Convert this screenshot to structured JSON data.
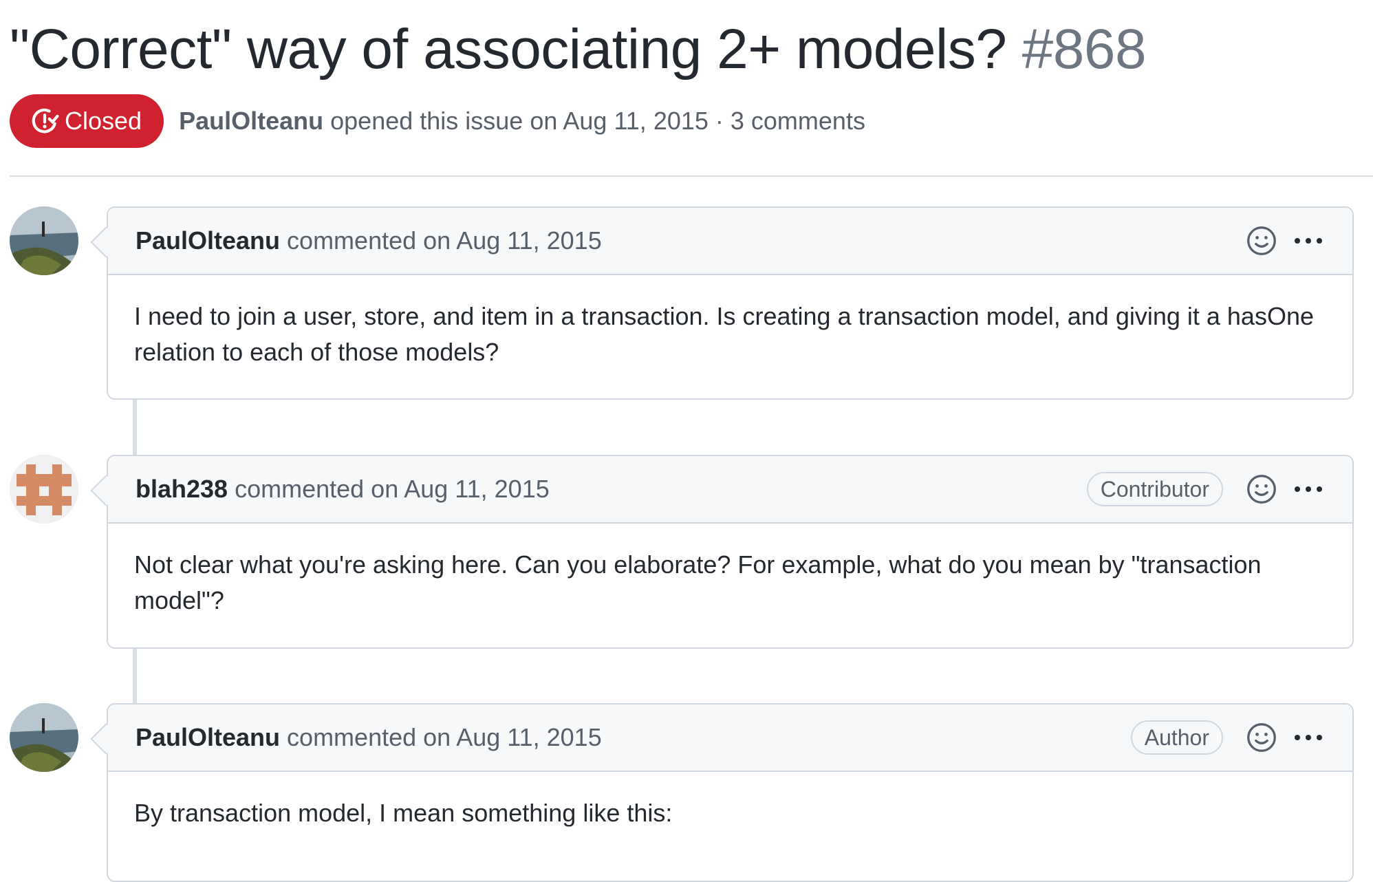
{
  "issue": {
    "title": "\"Correct\" way of associating 2+ models?",
    "number": "#868",
    "state": "Closed",
    "state_color": "#cf222e",
    "author": "PaulOlteanu",
    "opened_text": "opened this issue on Aug 11, 2015 · 3 comments"
  },
  "comments": [
    {
      "author": "PaulOlteanu",
      "timestamp": "commented on Aug 11, 2015",
      "role": "",
      "body": "I need to join a user, store, and item in a transaction. Is creating a transaction model, and giving it a hasOne relation to each of those models?",
      "avatar_icon": "landscape-avatar"
    },
    {
      "author": "blah238",
      "timestamp": "commented on Aug 11, 2015",
      "role": "Contributor",
      "body": "Not clear what you're asking here. Can you elaborate? For example, what do you mean by \"transaction model\"?",
      "avatar_icon": "identicon-avatar"
    },
    {
      "author": "PaulOlteanu",
      "timestamp": "commented on Aug 11, 2015",
      "role": "Author",
      "body": "By transaction model, I mean something like this:",
      "avatar_icon": "landscape-avatar"
    }
  ],
  "icons": {
    "state": "issue-closed-icon",
    "reaction": "smiley-icon",
    "menu": "kebab-horizontal-icon"
  }
}
